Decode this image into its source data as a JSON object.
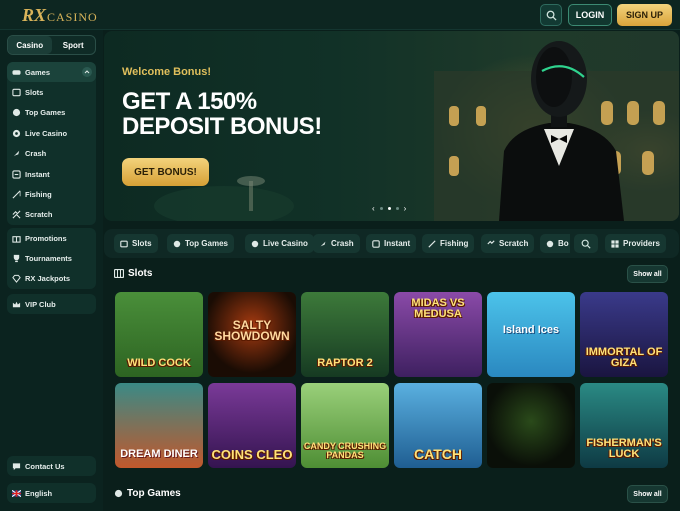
{
  "header": {
    "logo_rx": "RX",
    "logo_casino": "CASINO",
    "login": "LOGIN",
    "signup": "SIGN UP"
  },
  "sidebar": {
    "toggle": [
      "Casino",
      "Sport"
    ],
    "games_group": [
      {
        "label": "Games",
        "icon": "gamepad-icon"
      },
      {
        "label": "Slots",
        "icon": "slots-icon"
      },
      {
        "label": "Top Games",
        "icon": "crown-icon"
      },
      {
        "label": "Live Casino",
        "icon": "live-icon"
      },
      {
        "label": "Crash",
        "icon": "rocket-icon"
      },
      {
        "label": "Instant",
        "icon": "instant-icon"
      },
      {
        "label": "Fishing",
        "icon": "fishing-icon"
      },
      {
        "label": "Scratch",
        "icon": "scratch-icon"
      }
    ],
    "promo_group": [
      {
        "label": "Promotions",
        "icon": "gift-icon"
      },
      {
        "label": "Tournaments",
        "icon": "trophy-icon"
      },
      {
        "label": "RX Jackpots",
        "icon": "diamond-icon"
      }
    ],
    "vip": {
      "label": "VIP Club",
      "icon": "vip-icon"
    },
    "contact": {
      "label": "Contact Us",
      "icon": "chat-icon"
    },
    "language": {
      "label": "English",
      "icon": "uk-flag-icon"
    }
  },
  "hero": {
    "welcome": "Welcome Bonus!",
    "line1": "GET A 150%",
    "line2": "DEPOSIT BONUS!",
    "button": "GET BONUS!",
    "slide_total": 3,
    "slide_active": 1
  },
  "categories": [
    {
      "label": "Slots",
      "icon": "slots-icon"
    },
    {
      "label": "Top Games",
      "icon": "crown-icon"
    },
    {
      "label": "Live Casino",
      "icon": "live-icon"
    },
    {
      "label": "Crash",
      "icon": "rocket-icon"
    },
    {
      "label": "Instant",
      "icon": "instant-icon"
    },
    {
      "label": "Fishing",
      "icon": "fishing-icon"
    },
    {
      "label": "Scratch",
      "icon": "scratch-icon"
    },
    {
      "label": "Bo",
      "icon": "bonus-icon"
    },
    {
      "label": "Providers",
      "icon": "grid-icon"
    }
  ],
  "slots_section": {
    "title": "Slots",
    "show_all": "Show all",
    "games": [
      {
        "name": "WILD COCK",
        "bg": "#3d7a2c"
      },
      {
        "name": "SALTY SHOWDOWN",
        "bg": "#2a1608"
      },
      {
        "name": "RAPTOR 2",
        "bg": "#1f4a2c"
      },
      {
        "name": "MIDAS VS MEDUSA",
        "bg": "#6a3a8a"
      },
      {
        "name": "Island Ices",
        "bg": "#38a8d6"
      },
      {
        "name": "IMMORTAL OF GIZA",
        "bg": "#2b2466"
      },
      {
        "name": "DREAM DINER",
        "bg": "#2f7a7a"
      },
      {
        "name": "COINS CLEO",
        "bg": "#5e2a78"
      },
      {
        "name": "CANDY CRUSHING PANDAS",
        "bg": "#7ab548"
      },
      {
        "name": "CATCH",
        "bg": "#2a7ab8"
      },
      {
        "name": "",
        "bg": "#121a10"
      },
      {
        "name": "FISHERMAN'S LUCK",
        "bg": "#1a6a68"
      }
    ]
  },
  "top_section": {
    "title": "Top Games",
    "show_all": "Show all"
  }
}
